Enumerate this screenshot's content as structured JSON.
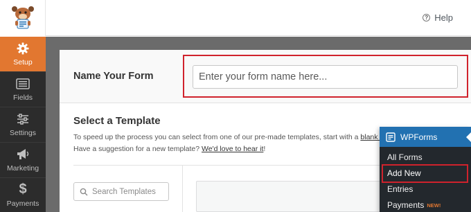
{
  "header": {
    "help_label": "Help"
  },
  "sidebar": {
    "items": [
      {
        "label": "Setup",
        "icon": "gear-icon",
        "active": true
      },
      {
        "label": "Fields",
        "icon": "fields-icon",
        "active": false
      },
      {
        "label": "Settings",
        "icon": "sliders-icon",
        "active": false
      },
      {
        "label": "Marketing",
        "icon": "megaphone-icon",
        "active": false
      },
      {
        "label": "Payments",
        "icon": "dollar-icon",
        "active": false
      }
    ]
  },
  "name_section": {
    "label": "Name Your Form",
    "input_placeholder": "Enter your form name here..."
  },
  "template_section": {
    "title": "Select a Template",
    "desc_line1_prefix": "To speed up the process you can select from one of our pre-made templates, start with a ",
    "desc_line1_link": "blank form",
    "desc_line2_prefix": "Have a suggestion for a new template? ",
    "desc_line2_link": "We'd love to hear it",
    "desc_line2_suffix": "!",
    "search_placeholder": "Search Templates"
  },
  "wp_menu": {
    "title": "WPForms",
    "items": [
      {
        "label": "All Forms"
      },
      {
        "label": "Add New"
      },
      {
        "label": "Entries"
      },
      {
        "label": "Payments",
        "badge": "NEW!"
      }
    ]
  },
  "colors": {
    "accent_orange": "#e27730",
    "highlight_red": "#d0222c",
    "wp_blue": "#2271b1",
    "sidebar_dark": "#2c2c2c"
  }
}
